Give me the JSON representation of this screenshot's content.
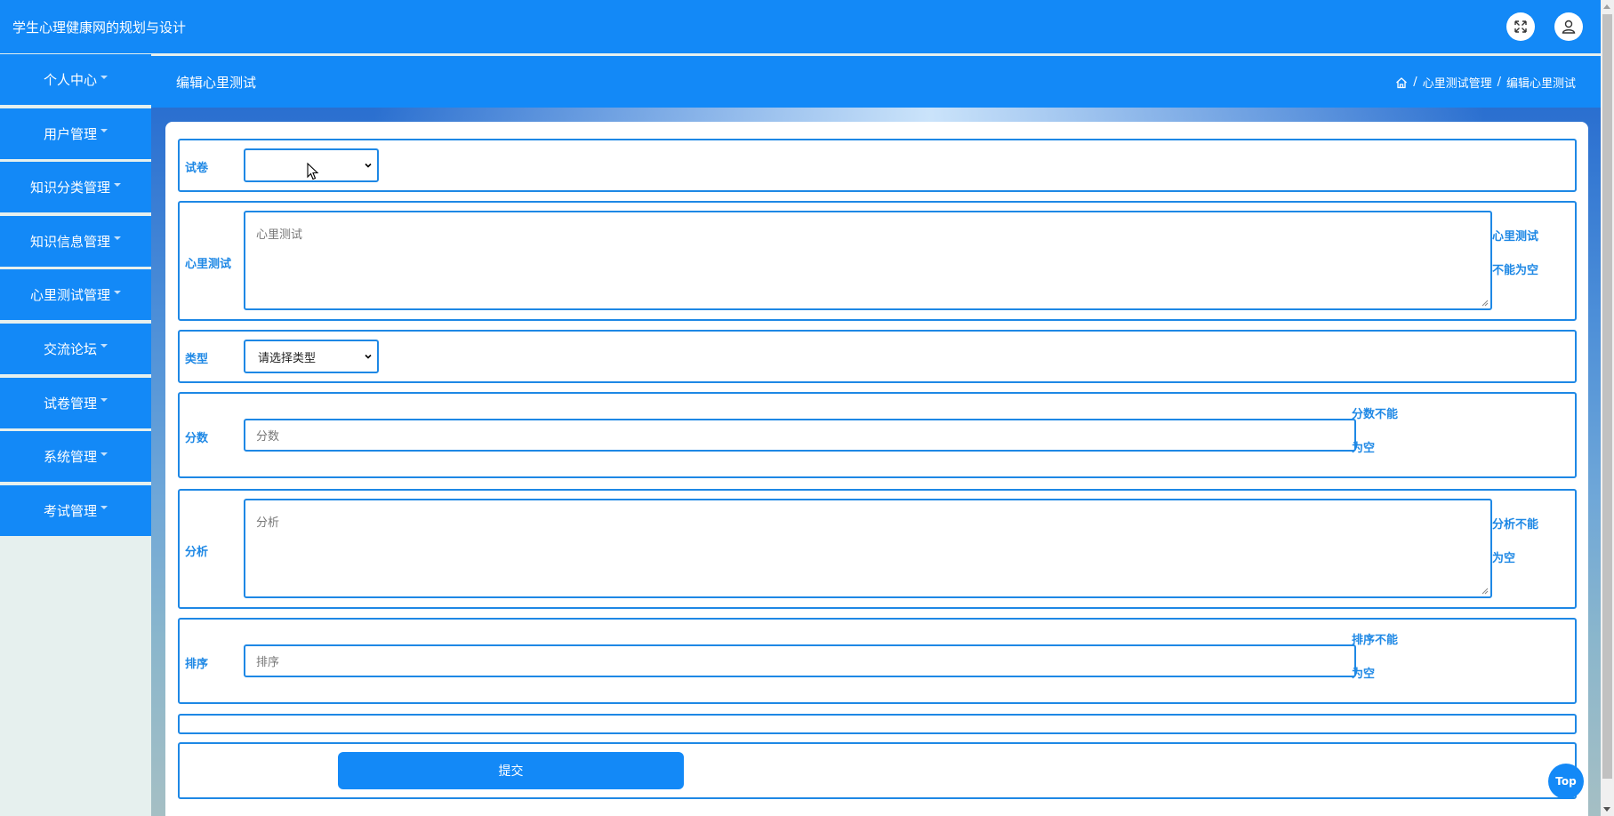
{
  "app": {
    "title": "学生心理健康网的规划与设计"
  },
  "header": {
    "page_title": "编辑心里测试",
    "breadcrumb": {
      "sep": "/",
      "parent": "心里测试管理",
      "current": "编辑心里测试"
    }
  },
  "sidebar": {
    "items": [
      {
        "label": "个人中心"
      },
      {
        "label": "用户管理"
      },
      {
        "label": "知识分类管理"
      },
      {
        "label": "知识信息管理"
      },
      {
        "label": "心里测试管理"
      },
      {
        "label": "交流论坛"
      },
      {
        "label": "试卷管理"
      },
      {
        "label": "系统管理"
      },
      {
        "label": "考试管理"
      }
    ]
  },
  "form": {
    "paper": {
      "label": "试卷",
      "value": ""
    },
    "test": {
      "label": "心里测试",
      "placeholder": "心里测试",
      "error_line1": "心里测试",
      "error_line2": "不能为空"
    },
    "type": {
      "label": "类型",
      "value": "请选择类型"
    },
    "score": {
      "label": "分数",
      "placeholder": "分数",
      "error_line1": "分数不能",
      "error_line2": "为空"
    },
    "analysis": {
      "label": "分析",
      "placeholder": "分析",
      "error_line1": "分析不能",
      "error_line2": "为空"
    },
    "sort": {
      "label": "排序",
      "placeholder": "排序",
      "error_line1": "排序不能",
      "error_line2": "为空"
    },
    "submit_label": "提交"
  },
  "top_button": "Top",
  "colors": {
    "primary": "#1389f7",
    "border": "#1e88e5",
    "sidebar_bg": "#e6f0ee"
  }
}
